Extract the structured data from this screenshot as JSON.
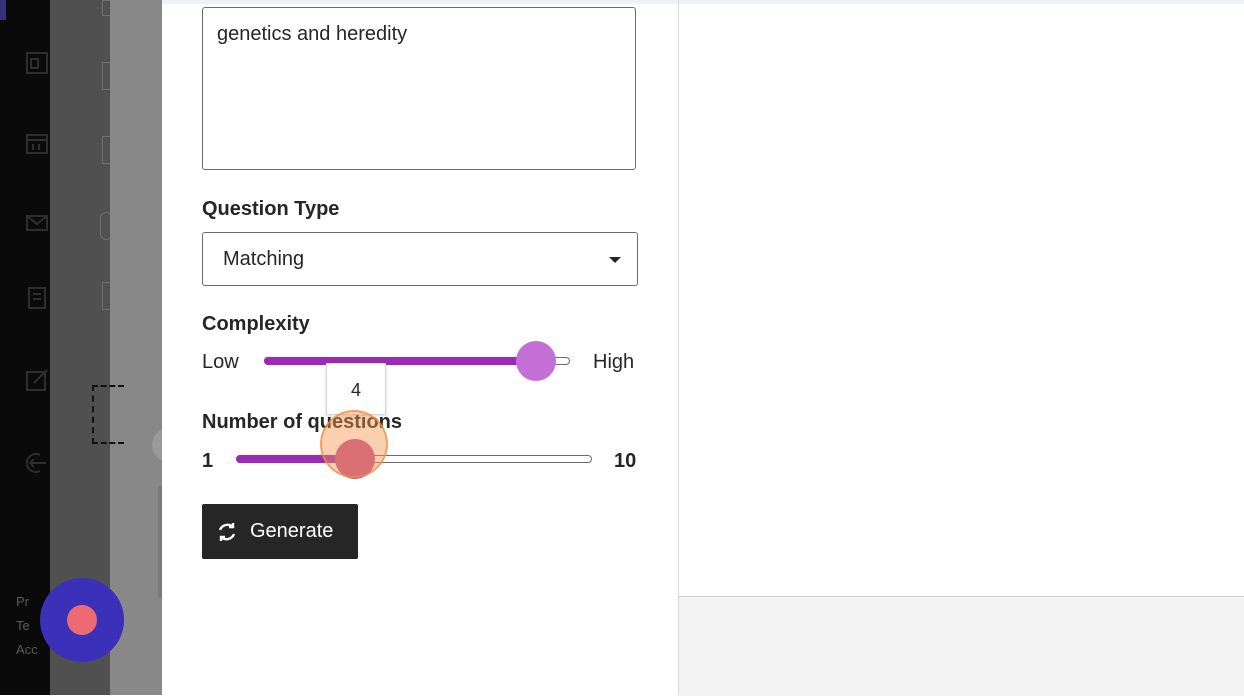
{
  "form": {
    "topic_value": "genetics and heredity",
    "question_type_label": "Question Type",
    "question_type_selected": "Matching",
    "complexity_label": "Complexity",
    "complexity_low": "Low",
    "complexity_high": "High",
    "complexity_level": 0.85,
    "questions_label": "Number of questions",
    "questions_min": "1",
    "questions_max": "10",
    "questions_value": "4",
    "generate_label": "Generate"
  },
  "background_footer": {
    "items": [
      "Pr",
      "Te",
      "Acc"
    ]
  },
  "icons": {
    "nav": [
      "dashboard-icon",
      "calendar-icon",
      "messages-icon",
      "grades-icon",
      "edit-icon",
      "sign-out-icon"
    ],
    "generate": "refresh-icon",
    "record": "record-icon"
  },
  "colors": {
    "accent": "#9b2bb5",
    "thumb": "#c36fd6",
    "record_button": "#3b30b8",
    "record_dot": "#ee6a72",
    "click_indicator": "#f39650"
  }
}
